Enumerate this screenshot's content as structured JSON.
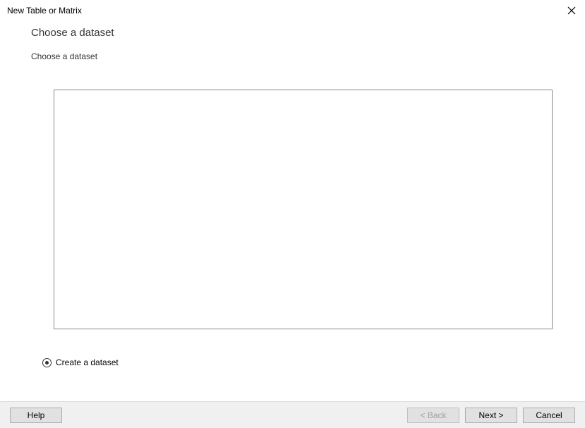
{
  "titlebar": {
    "title": "New Table or Matrix"
  },
  "content": {
    "heading": "Choose a dataset",
    "subheading": "Choose a dataset"
  },
  "radio": {
    "create_label": "Create a dataset"
  },
  "footer": {
    "help_label": "Help",
    "back_label": "< Back",
    "next_label": "Next >",
    "cancel_label": "Cancel"
  }
}
